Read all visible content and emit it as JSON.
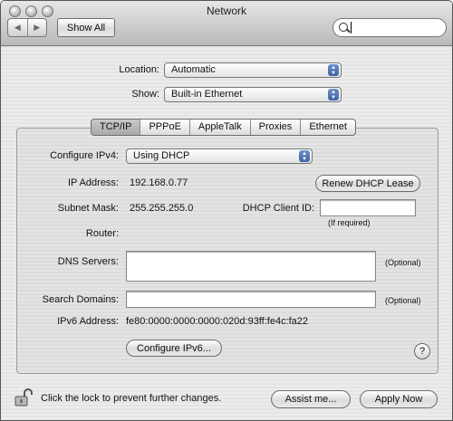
{
  "window": {
    "title": "Network"
  },
  "toolbar": {
    "show_all_label": "Show All",
    "back_glyph": "◀",
    "forward_glyph": "▶",
    "search_value": ""
  },
  "location": {
    "label": "Location:",
    "value": "Automatic"
  },
  "show": {
    "label": "Show:",
    "value": "Built-in Ethernet"
  },
  "tabs": [
    "TCP/IP",
    "PPPoE",
    "AppleTalk",
    "Proxies",
    "Ethernet"
  ],
  "tcpip": {
    "configure_label": "Configure IPv4:",
    "configure_value": "Using DHCP",
    "ip_label": "IP Address:",
    "ip_value": "192.168.0.77",
    "renew_label": "Renew DHCP Lease",
    "subnet_label": "Subnet Mask:",
    "subnet_value": "255.255.255.0",
    "client_id_label": "DHCP Client ID:",
    "client_id_value": "",
    "if_required": "(If required)",
    "router_label": "Router:",
    "router_value": "",
    "dns_label": "DNS Servers:",
    "dns_value": "",
    "dns_optional": "(Optional)",
    "search_domains_label": "Search Domains:",
    "search_domains_value": "",
    "search_optional": "(Optional)",
    "ipv6_label": "IPv6 Address:",
    "ipv6_value": "fe80:0000:0000:0000:020d:93ff:fe4c:fa22",
    "configure_ipv6_label": "Configure IPv6..."
  },
  "footer": {
    "lock_text": "Click the lock to prevent further changes.",
    "assist_label": "Assist me...",
    "apply_label": "Apply Now",
    "help_glyph": "?"
  }
}
